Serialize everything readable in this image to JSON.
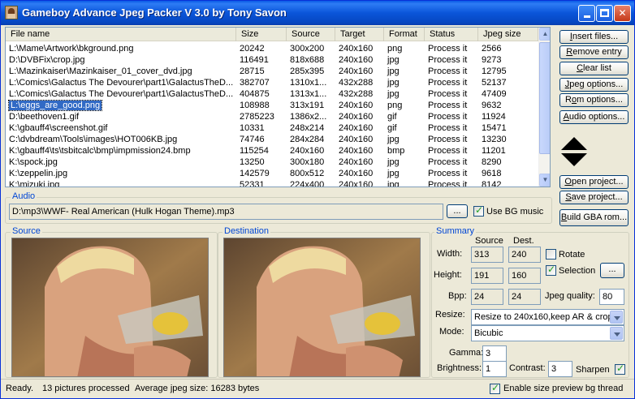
{
  "window": {
    "title": "Gameboy Advance Jpeg Packer V 3.0 by Tony Savon"
  },
  "columns": [
    {
      "label": "File name"
    },
    {
      "label": "Size"
    },
    {
      "label": "Source"
    },
    {
      "label": "Target"
    },
    {
      "label": "Format"
    },
    {
      "label": "Status"
    },
    {
      "label": "Jpeg size"
    }
  ],
  "rows": [
    {
      "file": "L:\\Mame\\Artwork\\bkground.png",
      "size": "20242",
      "source": "300x200",
      "target": "240x160",
      "format": "png",
      "status": "Process it",
      "jpeg": "2566"
    },
    {
      "file": "D:\\DVBFix\\crop.jpg",
      "size": "116491",
      "source": "818x688",
      "target": "240x160",
      "format": "jpg",
      "status": "Process it",
      "jpeg": "9273"
    },
    {
      "file": "L:\\Mazinkaiser\\Mazinkaiser_01_cover_dvd.jpg",
      "size": "28715",
      "source": "285x395",
      "target": "240x160",
      "format": "jpg",
      "status": "Process it",
      "jpeg": "12795"
    },
    {
      "file": "L:\\Comics\\Galactus The Devourer\\part1\\GalactusTheD...",
      "size": "382707",
      "source": "1310x1...",
      "target": "432x288",
      "format": "jpg",
      "status": "Process it",
      "jpeg": "52137"
    },
    {
      "file": "L:\\Comics\\Galactus The Devourer\\part1\\GalactusTheD...",
      "size": "404875",
      "source": "1313x1...",
      "target": "432x288",
      "format": "jpg",
      "status": "Process it",
      "jpeg": "47409"
    },
    {
      "file": "L:\\eggs_are_good.png",
      "size": "108988",
      "source": "313x191",
      "target": "240x160",
      "format": "png",
      "status": "Process it",
      "jpeg": "9632"
    },
    {
      "file": "D:\\beethoven1.gif",
      "size": "2785223",
      "source": "1386x2...",
      "target": "240x160",
      "format": "gif",
      "status": "Process it",
      "jpeg": "11924"
    },
    {
      "file": "K:\\gbauff4\\screenshot.gif",
      "size": "10331",
      "source": "248x214",
      "target": "240x160",
      "format": "gif",
      "status": "Process it",
      "jpeg": "15471"
    },
    {
      "file": "C:\\dvbdream\\Tools\\images\\HOT006KB.jpg",
      "size": "74746",
      "source": "284x284",
      "target": "240x160",
      "format": "jpg",
      "status": "Process it",
      "jpeg": "13230"
    },
    {
      "file": "K:\\gbauff4\\ts\\tsbitcalc\\bmp\\impmission24.bmp",
      "size": "115254",
      "source": "240x160",
      "target": "240x160",
      "format": "bmp",
      "status": "Process it",
      "jpeg": "11201"
    },
    {
      "file": "K:\\spock.jpg",
      "size": "13250",
      "source": "300x180",
      "target": "240x160",
      "format": "jpg",
      "status": "Process it",
      "jpeg": "8290"
    },
    {
      "file": "K:\\zeppelin.jpg",
      "size": "142579",
      "source": "800x512",
      "target": "240x160",
      "format": "jpg",
      "status": "Process it",
      "jpeg": "9618"
    },
    {
      "file": "K:\\mizuki.jpg",
      "size": "52331",
      "source": "224x400",
      "target": "240x160",
      "format": "jpg",
      "status": "Process it",
      "jpeg": "8142"
    }
  ],
  "selected_row": 5,
  "buttons": {
    "insert": {
      "pre": "",
      "u": "I",
      "post": "nsert files..."
    },
    "remove": {
      "pre": "",
      "u": "R",
      "post": "emove entry"
    },
    "clear": {
      "pre": "",
      "u": "C",
      "post": "lear list"
    },
    "jpeg_opts": {
      "pre": "",
      "u": "J",
      "post": "peg options..."
    },
    "rom_opts": {
      "pre": "R",
      "u": "o",
      "post": "m options..."
    },
    "audio_opts": {
      "pre": "",
      "u": "A",
      "post": "udio options..."
    },
    "open_project": {
      "pre": "",
      "u": "O",
      "post": "pen project..."
    },
    "save_project": {
      "pre": "",
      "u": "S",
      "post": "ave project..."
    },
    "build": {
      "pre": "",
      "u": "B",
      "post": "uild GBA rom..."
    },
    "browse_audio": "...",
    "selection_browse": "..."
  },
  "audio": {
    "label": "Audio",
    "path": "D:\\mp3\\WWF- Real American (Hulk Hogan Theme).mp3",
    "use_bg_label": "Use BG music",
    "use_bg_checked": true
  },
  "source_label": "Source",
  "destination_label": "Destination",
  "summary": {
    "label": "Summary",
    "col_source": "Source",
    "col_dest": "Dest.",
    "width_label": "Width:",
    "width_src": "313",
    "width_dst": "240",
    "height_label": "Height:",
    "height_src": "191",
    "height_dst": "160",
    "bpp_label": "Bpp:",
    "bpp_src": "24",
    "bpp_dst": "24",
    "rotate_label": "Rotate",
    "rotate_checked": false,
    "selection_label": "Selection",
    "selection_checked": true,
    "jpeg_quality_label": "Jpeg quality:",
    "jpeg_quality": "80",
    "resize_label": "Resize:",
    "resize_value": "Resize to 240x160,keep AR & crop",
    "mode_label": "Mode:",
    "mode_value": "Bicubic",
    "gamma_label": "Gamma:",
    "gamma": "3",
    "brightness_label": "Brightness:",
    "brightness": "1",
    "contrast_label": "Contrast:",
    "contrast": "3",
    "sharpen_label": "Sharpen",
    "sharpen_checked": true
  },
  "status": {
    "ready": "Ready.",
    "processed": "13 pictures processed",
    "average": "Average jpeg size: 16283 bytes",
    "preview_thread_label": "Enable size preview bg thread",
    "preview_thread_checked": true
  }
}
